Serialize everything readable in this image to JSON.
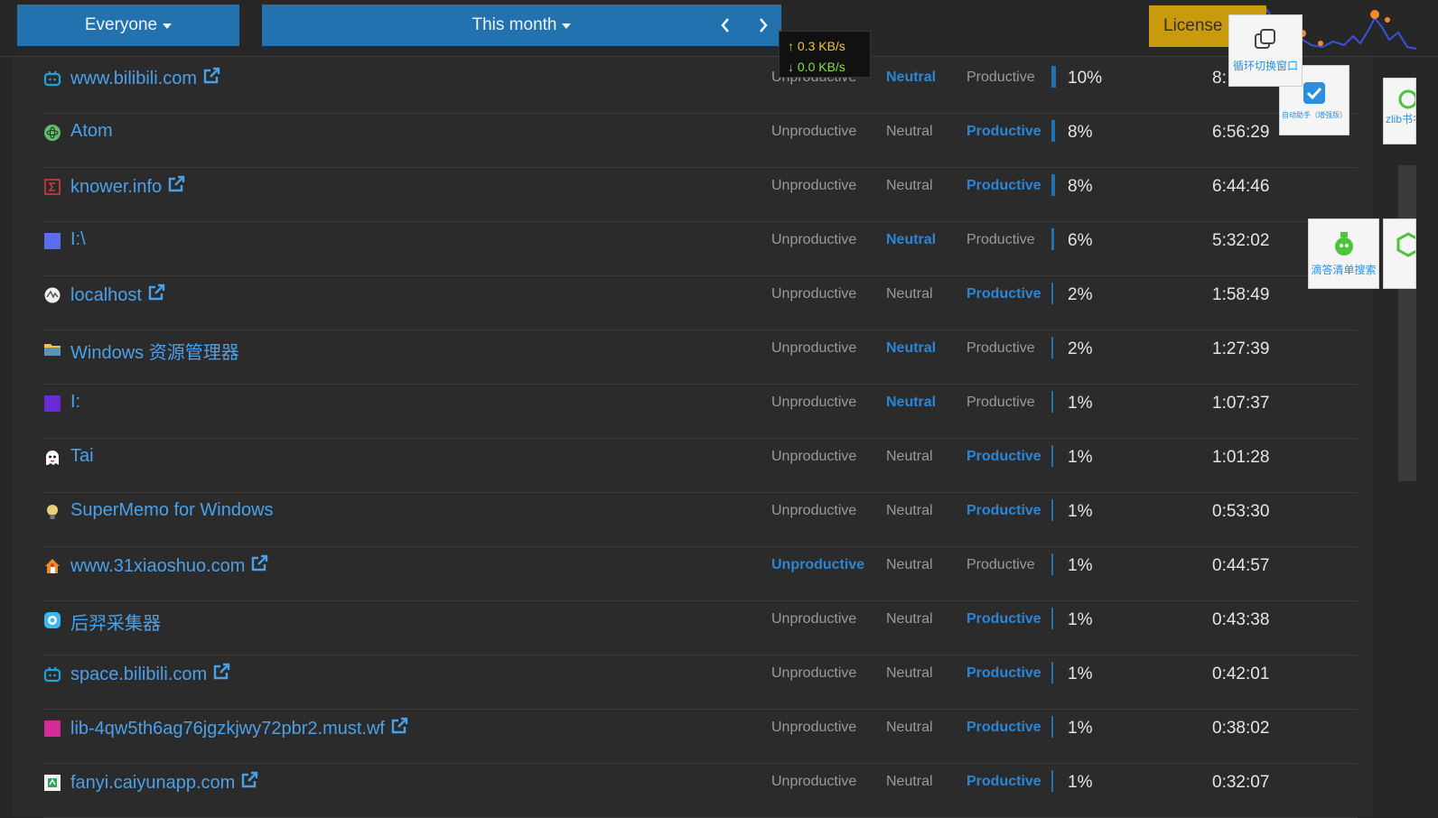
{
  "toolbar": {
    "user_filter": "Everyone",
    "period_filter": "This month",
    "license_label": "License"
  },
  "netspeed": {
    "upload": "0.3 KB/s",
    "download": "0.0 KB/s"
  },
  "category_labels": {
    "unproductive": "Unproductive",
    "neutral": "Neutral",
    "productive": "Productive"
  },
  "rows": [
    {
      "name": "www.bilibili.com",
      "external": true,
      "category": "neutral",
      "percent": "10%",
      "share": 0.1,
      "duration": "8:",
      "icon": "bilibili-tv-icon",
      "icon_color": "#23a0d8"
    },
    {
      "name": "Atom",
      "external": false,
      "category": "productive",
      "percent": "8%",
      "share": 0.08,
      "duration": "6:56:29",
      "icon": "atom-icon",
      "icon_color": "#5fbe6a"
    },
    {
      "name": "knower.info",
      "external": true,
      "category": "productive",
      "percent": "8%",
      "share": 0.08,
      "duration": "6:44:46",
      "icon": "sigma-icon",
      "icon_color": "#d23c3c"
    },
    {
      "name": "I:\\",
      "external": false,
      "category": "neutral",
      "percent": "6%",
      "share": 0.06,
      "duration": "5:32:02",
      "icon": "square-icon",
      "icon_color": "#5a6cf0"
    },
    {
      "name": "localhost",
      "external": true,
      "category": "productive",
      "percent": "2%",
      "share": 0.02,
      "duration": "1:58:49",
      "icon": "globe-icon",
      "icon_color": "#f0f0f0"
    },
    {
      "name": "Windows 资源管理器",
      "external": false,
      "category": "neutral",
      "percent": "2%",
      "share": 0.02,
      "duration": "1:27:39",
      "icon": "folder-icon",
      "icon_color": "#f4c542"
    },
    {
      "name": "I:",
      "external": false,
      "category": "neutral",
      "percent": "1%",
      "share": 0.01,
      "duration": "1:07:37",
      "icon": "square-icon",
      "icon_color": "#6a2ad8"
    },
    {
      "name": "Tai",
      "external": false,
      "category": "productive",
      "percent": "1%",
      "share": 0.01,
      "duration": "1:01:28",
      "icon": "ghost-icon",
      "icon_color": "#ffffff"
    },
    {
      "name": "SuperMemo for Windows",
      "external": false,
      "category": "productive",
      "percent": "1%",
      "share": 0.01,
      "duration": "0:53:30",
      "icon": "bulb-icon",
      "icon_color": "#e8d07a"
    },
    {
      "name": "www.31xiaoshuo.com",
      "external": true,
      "category": "unproductive",
      "percent": "1%",
      "share": 0.01,
      "duration": "0:44:57",
      "icon": "house-icon",
      "icon_color": "#f08a2a"
    },
    {
      "name": "后羿采集器",
      "external": false,
      "category": "productive",
      "percent": "1%",
      "share": 0.01,
      "duration": "0:43:38",
      "icon": "collector-icon",
      "icon_color": "#3cb8f0"
    },
    {
      "name": "space.bilibili.com",
      "external": true,
      "category": "productive",
      "percent": "1%",
      "share": 0.01,
      "duration": "0:42:01",
      "icon": "bilibili-tv-icon",
      "icon_color": "#23a0d8"
    },
    {
      "name": "lib-4qw5th6ag76jgzkjwy72pbr2.must.wf",
      "external": true,
      "category": "productive",
      "percent": "1%",
      "share": 0.01,
      "duration": "0:38:02",
      "icon": "square-icon",
      "icon_color": "#d42a9a"
    },
    {
      "name": "fanyi.caiyunapp.com",
      "external": true,
      "category": "productive",
      "percent": "1%",
      "share": 0.01,
      "duration": "0:32:07",
      "icon": "caiyun-icon",
      "icon_color": "#2ca65a"
    }
  ],
  "floating_widgets": {
    "window_cycle": "循环切换窗口",
    "auto_helper": "自动助手（增强版）",
    "zlib_label": "zlib书名",
    "didi_search": "滴答清单搜索"
  },
  "colors": {
    "accent_blue": "#2272b0",
    "license_gold": "#c99a0c",
    "link_blue": "#4ba0ea"
  }
}
